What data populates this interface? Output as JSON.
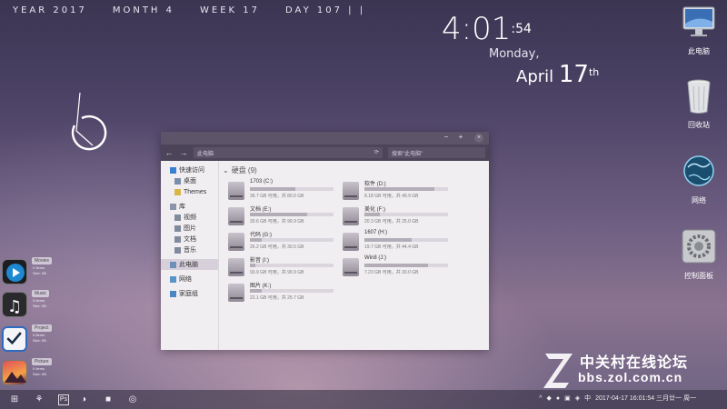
{
  "topline": {
    "year": "YEAR 2017",
    "month": "MONTH 4",
    "week": "WEEK 17",
    "day": "DAY 107 | |"
  },
  "clock": {
    "hm": "4:01",
    "sec": ":54",
    "weekday": "Monday,",
    "month": "April",
    "day": "17",
    "suffix": "th"
  },
  "desktop_icons": [
    {
      "label": "此电脑",
      "icon": "computer-icon"
    },
    {
      "label": "回收站",
      "icon": "recycle-bin-icon"
    },
    {
      "label": "网络",
      "icon": "network-icon"
    },
    {
      "label": "控制面板",
      "icon": "control-panel-icon"
    }
  ],
  "launchers": [
    {
      "title": "Movies",
      "items": "0 Items",
      "size": "Size: 0B",
      "icon": "play-icon"
    },
    {
      "title": "Music",
      "items": "0 Items",
      "size": "Size: 0B",
      "icon": "music-icon"
    },
    {
      "title": "Project",
      "items": "0 Items",
      "size": "Size: 0B",
      "icon": "check-icon"
    },
    {
      "title": "Picture",
      "items": "0 Items",
      "size": "Size: 0B",
      "icon": "picture-icon"
    }
  ],
  "explorer": {
    "path": "此电脑",
    "search_placeholder": "搜索\"此电脑\"",
    "sidebar": [
      {
        "label": "快速访问",
        "sub": false
      },
      {
        "label": "桌面",
        "sub": true
      },
      {
        "label": "Themes",
        "sub": true
      },
      {
        "label": "库",
        "sub": false
      },
      {
        "label": "视频",
        "sub": true
      },
      {
        "label": "图片",
        "sub": true
      },
      {
        "label": "文档",
        "sub": true
      },
      {
        "label": "音乐",
        "sub": true
      },
      {
        "label": "此电脑",
        "sub": false
      },
      {
        "label": "网络",
        "sub": false
      },
      {
        "label": "家庭组",
        "sub": false
      }
    ],
    "group_title": "硬盘 (9)",
    "drives": [
      {
        "name": "1703 (C:)",
        "size": "36.7 GB 可用，共 80.0 GB",
        "used": 0.54
      },
      {
        "name": "软件 (D:)",
        "size": "8.18 GB 可用，共 49.9 GB",
        "used": 0.84
      },
      {
        "name": "文档 (E:)",
        "size": "30.6 GB 可用，共 99.9 GB",
        "used": 0.69
      },
      {
        "name": "美化 (F:)",
        "size": "20.3 GB 可用，共 25.0 GB",
        "used": 0.19
      },
      {
        "name": "代码 (G:)",
        "size": "26.2 GB 可用，共 30.5 GB",
        "used": 0.14
      },
      {
        "name": "1607 (H:)",
        "size": "19.7 GB 可用，共 44.4 GB",
        "used": 0.56
      },
      {
        "name": "影音 (I:)",
        "size": "93.9 GB 可用，共 99.9 GB",
        "used": 0.06
      },
      {
        "name": "Win8 (J:)",
        "size": "7.23 GB 可用，共 30.0 GB",
        "used": 0.76
      },
      {
        "name": "图片 (K:)",
        "size": "22.1 GB 可用，共 25.7 GB",
        "used": 0.14
      }
    ]
  },
  "tray": {
    "datetime": "2017-04-17 16:01:54 三月廿一 周一",
    "lang": "中"
  },
  "watermark": {
    "cn": "中关村在线论坛",
    "url": "bbs.zol.com.cn"
  }
}
